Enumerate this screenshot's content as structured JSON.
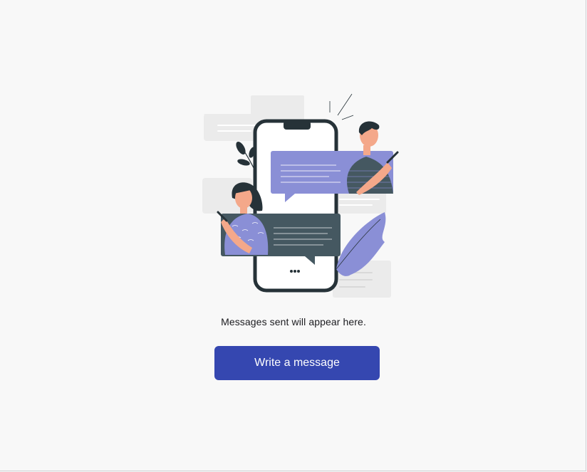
{
  "empty_state": {
    "message": "Messages sent will appear here.",
    "button_label": "Write a message",
    "illustration": "chat-messages-illustration"
  },
  "colors": {
    "background": "#f8f8f8",
    "primary_button": "#3547b0",
    "bubble_purple": "#8a8fd6",
    "bubble_dark": "#455861",
    "phone_outline": "#263238"
  }
}
